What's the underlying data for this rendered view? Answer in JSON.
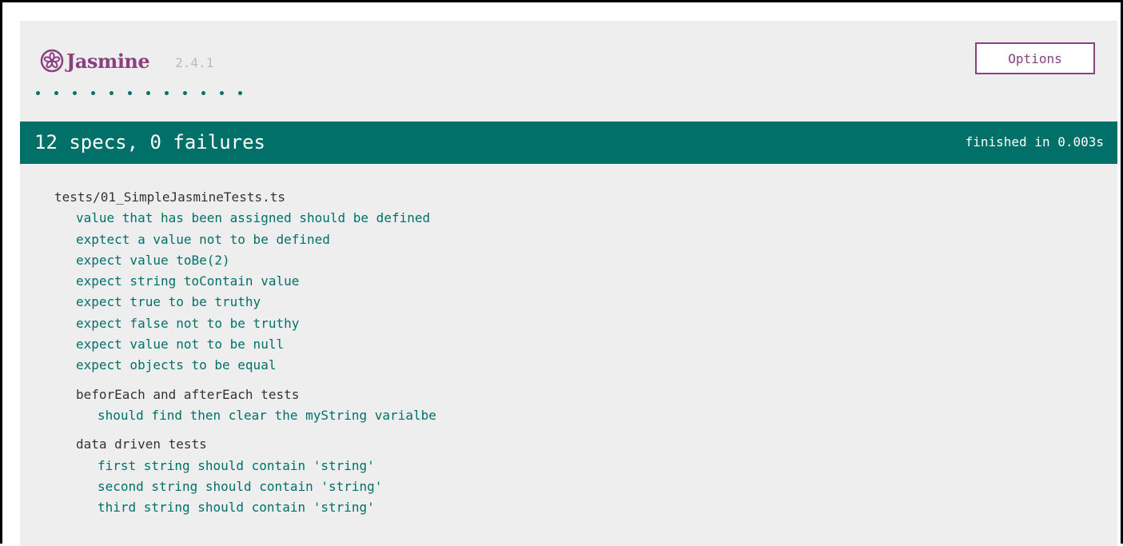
{
  "header": {
    "logo_text": "Jasmine",
    "version": "2.4.1",
    "options_label": "Options",
    "brand_color": "#8a4182"
  },
  "progress": {
    "spec_dot_count": 12,
    "status": "passed",
    "dot_color": "#007069"
  },
  "summary": {
    "text": "12 specs, 0 failures",
    "duration": "finished in 0.003s",
    "bar_color": "#007069"
  },
  "results": {
    "suite_title": "tests/01_SimpleJasmineTests.ts",
    "specs": [
      "value that has been assigned should be defined",
      "exptect a value not to be defined",
      "expect value toBe(2)",
      "expect string toContain value",
      "expect true to be truthy",
      "expect false not to be truthy",
      "expect value not to be null",
      "expect objects to be equal"
    ],
    "subsuites": [
      {
        "title": "beforEach and afterEach tests",
        "specs": [
          "should find then clear the myString varialbe"
        ]
      },
      {
        "title": "data driven tests",
        "specs": [
          "first string should contain 'string'",
          "second string should contain 'string'",
          "third string should contain 'string'"
        ]
      }
    ]
  }
}
